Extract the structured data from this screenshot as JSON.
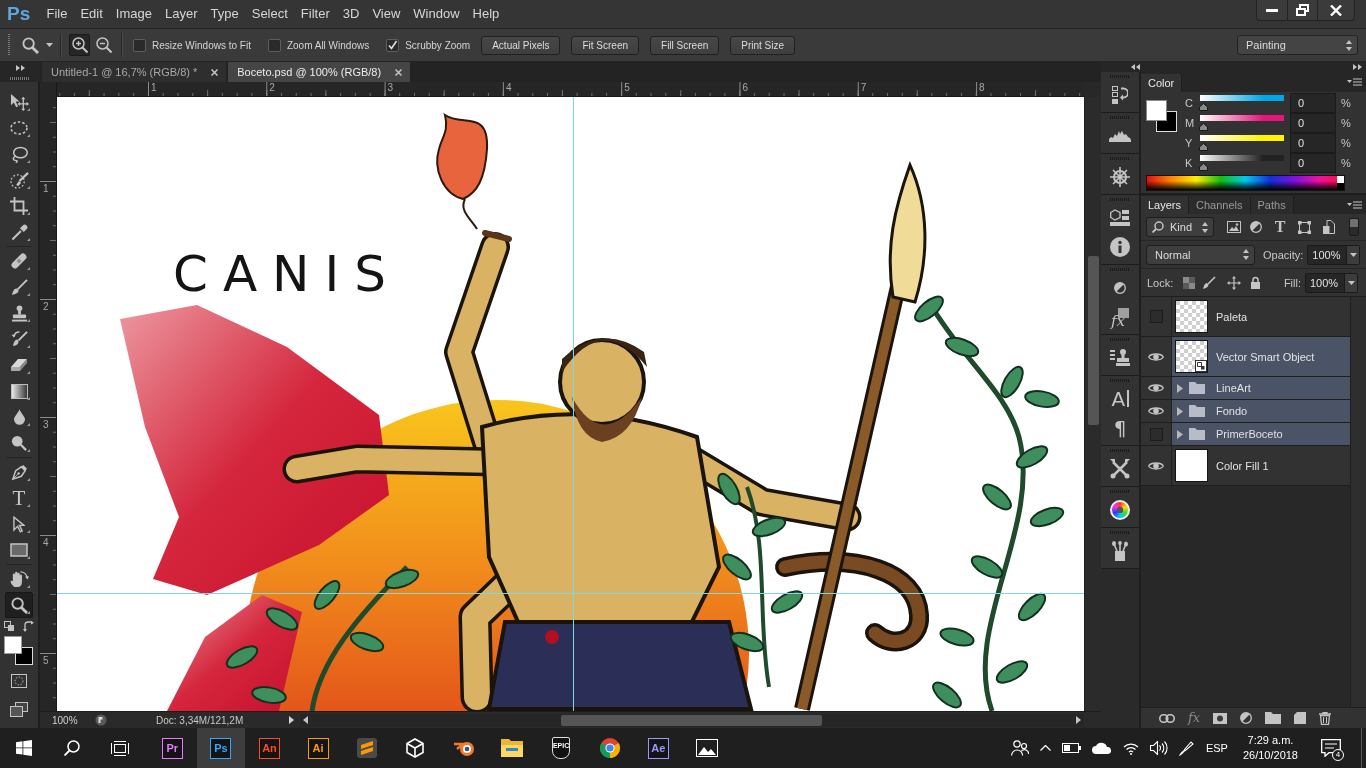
{
  "app": {
    "logo": "Ps"
  },
  "menu": [
    "File",
    "Edit",
    "Image",
    "Layer",
    "Type",
    "Select",
    "Filter",
    "3D",
    "View",
    "Window",
    "Help"
  ],
  "options_bar": {
    "zoom_modes": [
      {
        "kind": "zoomin",
        "selected": true
      },
      {
        "kind": "zoomout",
        "selected": false
      }
    ],
    "checkboxes": [
      {
        "label": "Resize Windows to Fit",
        "checked": false
      },
      {
        "label": "Zoom All Windows",
        "checked": false
      },
      {
        "label": "Scrubby Zoom",
        "checked": true
      }
    ],
    "buttons": [
      "Actual Pixels",
      "Fit Screen",
      "Fill Screen",
      "Print Size"
    ],
    "workspace": "Painting"
  },
  "document_tabs": [
    {
      "title": "Untitled-1 @ 16,7% (RGB/8) *",
      "selected": false
    },
    {
      "title": "Boceto.psd @ 100% (RGB/8)",
      "selected": true
    }
  ],
  "tool_groups": [
    [
      {
        "kind": "move",
        "selected": false
      },
      {
        "kind": "marquee",
        "selected": false
      },
      {
        "kind": "lasso",
        "selected": false
      },
      {
        "kind": "quickselect",
        "selected": false
      },
      {
        "kind": "crop",
        "selected": false
      },
      {
        "kind": "eyedropper",
        "selected": false
      }
    ],
    [
      {
        "kind": "healing",
        "selected": false
      },
      {
        "kind": "brush",
        "selected": false
      },
      {
        "kind": "stamp",
        "selected": false
      },
      {
        "kind": "historybrush",
        "selected": false
      },
      {
        "kind": "eraser",
        "selected": false
      },
      {
        "kind": "gradient",
        "selected": false
      },
      {
        "kind": "blur",
        "selected": false
      },
      {
        "kind": "dodge",
        "selected": false
      }
    ],
    [
      {
        "kind": "pen",
        "selected": false
      },
      {
        "kind": "type",
        "glyph": "T",
        "selected": false
      },
      {
        "kind": "pathselect",
        "selected": false
      },
      {
        "kind": "rectangle",
        "selected": false
      }
    ],
    [
      {
        "kind": "rotateview",
        "selected": false
      },
      {
        "kind": "zoom",
        "selected": true
      }
    ]
  ],
  "tool_colors": [
    {
      "kind": "foreground",
      "color": "#ffffff"
    },
    {
      "kind": "background",
      "color": "#000000"
    }
  ],
  "rulers": {
    "horizontal": [
      "1",
      "2",
      "3",
      "4",
      "5",
      "6",
      "7",
      "8"
    ],
    "vertical": [
      "1",
      "2",
      "3",
      "4",
      "5"
    ]
  },
  "canvas": {
    "title": "CANIS"
  },
  "status_bar": {
    "zoom": "100%",
    "document_size": "Doc: 3,34M/121,2M"
  },
  "panel_dock": {
    "styles": "fx",
    "character": "A",
    "paragraph": "¶"
  },
  "color_panel": {
    "tab": "Color",
    "swatches": [
      {
        "kind": "foreground",
        "color": "#ffffff"
      },
      {
        "kind": "background",
        "color": "#000000"
      }
    ],
    "channels": [
      {
        "label": "C",
        "color": "#00a8e8",
        "level": 0,
        "value": "0",
        "unit": "%"
      },
      {
        "label": "M",
        "color": "#e6157d",
        "level": 0,
        "value": "0",
        "unit": "%"
      },
      {
        "label": "Y",
        "color": "#fff200",
        "level": 0,
        "value": "0",
        "unit": "%"
      },
      {
        "label": "K",
        "color": "#222222",
        "level": 0,
        "value": "0",
        "unit": "%"
      }
    ]
  },
  "layers_panel": {
    "tabs": [
      {
        "label": "Layers",
        "selected": true
      },
      {
        "label": "Channels",
        "selected": false
      },
      {
        "label": "Paths",
        "selected": false
      }
    ],
    "filter": "Kind",
    "type_filter": "T",
    "blend_mode": "Normal",
    "opacity_label": "Opacity:",
    "opacity": "100%",
    "lock_label": "Lock:",
    "fill_label": "Fill:",
    "fill": "100%",
    "layers": [
      {
        "name": "Paleta",
        "kind": "layer",
        "visible": false,
        "selected": false
      },
      {
        "name": "Vector Smart Object",
        "kind": "smart",
        "visible": true,
        "selected": true
      },
      {
        "name": "LineArt",
        "kind": "group",
        "expanded": false,
        "visible": true,
        "selected": true
      },
      {
        "name": "Fondo",
        "kind": "group",
        "expanded": false,
        "visible": true,
        "selected": true
      },
      {
        "name": "PrimerBoceto",
        "kind": "group",
        "expanded": false,
        "visible": false,
        "selected": true
      },
      {
        "name": "Color Fill 1",
        "kind": "fill",
        "visible": true,
        "selected": false
      }
    ],
    "effects_button": "fx"
  },
  "taskbar": {
    "apps": [
      {
        "kind": "tile",
        "label": "Pr",
        "color": "#ea77ff",
        "selected": false
      },
      {
        "kind": "tile",
        "label": "Ps",
        "color": "#31a8ff",
        "selected": true
      },
      {
        "kind": "tile",
        "label": "An",
        "color": "#ff4b1f",
        "selected": false
      },
      {
        "kind": "tile",
        "label": "Ai",
        "color": "#ff9a00",
        "selected": false
      },
      {
        "kind": "stripes",
        "selected": false
      },
      {
        "kind": "cube",
        "selected": false
      },
      {
        "kind": "orbit",
        "selected": false
      },
      {
        "kind": "folder",
        "selected": false
      },
      {
        "kind": "shield",
        "label": "EPIC",
        "selected": false
      },
      {
        "kind": "wheel",
        "selected": false
      },
      {
        "kind": "tile",
        "label": "Ae",
        "color": "#9999ff",
        "selected": false
      },
      {
        "kind": "picture",
        "selected": false
      }
    ],
    "language": "ESP",
    "time": "7:29 a.m.",
    "date": "26/10/2018",
    "notifications": "4"
  }
}
